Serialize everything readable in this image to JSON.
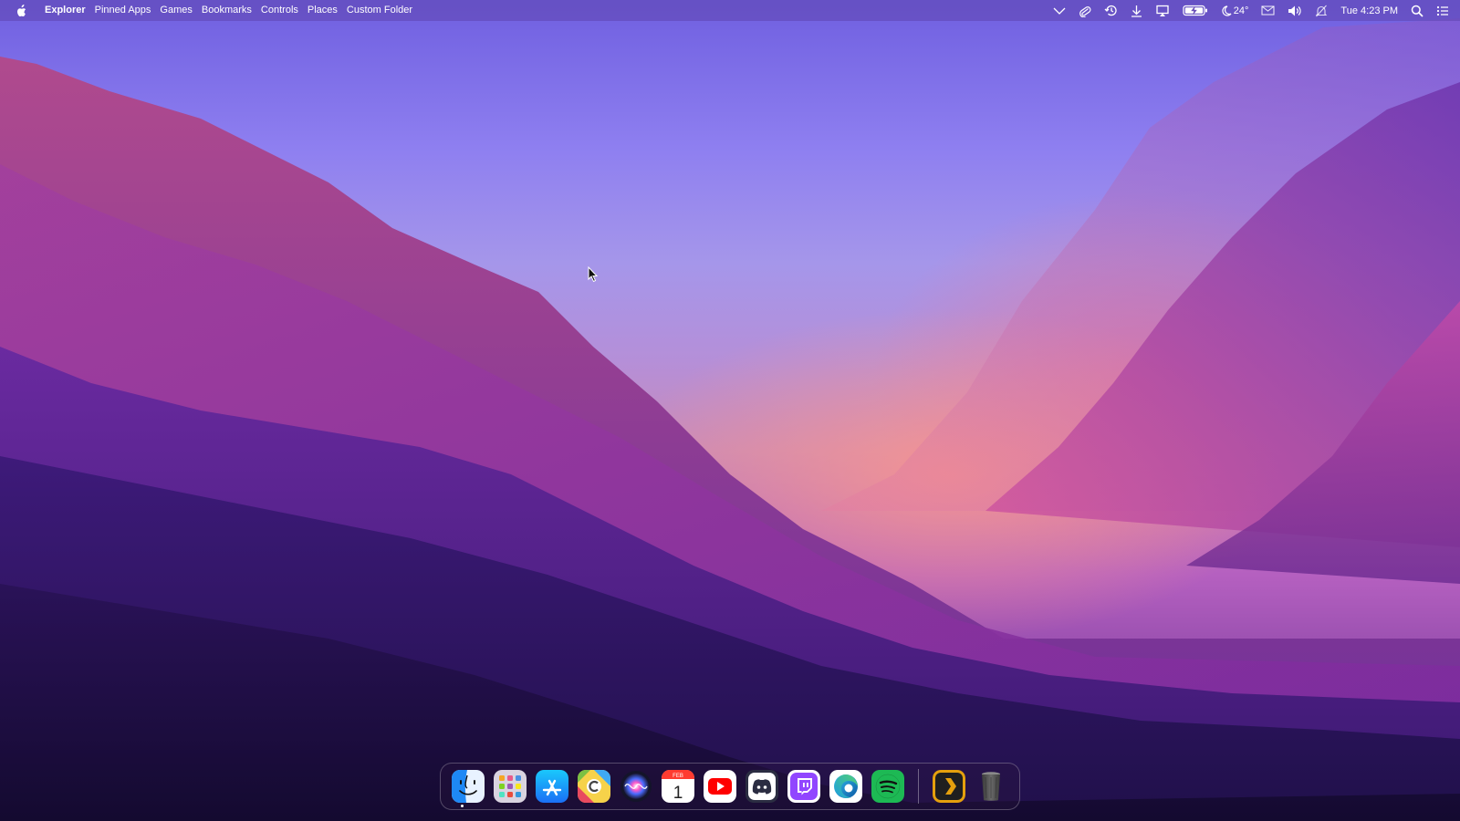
{
  "menubar": {
    "app_name": "Explorer",
    "menus": [
      "Pinned Apps",
      "Games",
      "Bookmarks",
      "Controls",
      "Places",
      "Custom Folder"
    ],
    "weather_temp": "24°",
    "clock": "Tue 4:23 PM"
  },
  "status_icons": [
    "chevron-down-icon",
    "paperclip-icon",
    "history-icon",
    "download-icon",
    "screen-mirror-icon",
    "battery-charging-icon",
    "moon-weather-icon",
    "mail-icon",
    "volume-icon",
    "notifications-off-icon",
    "search-icon",
    "control-center-icon"
  ],
  "dock": {
    "apps": [
      {
        "name": "Finder",
        "icon": "finder-icon",
        "running": true
      },
      {
        "name": "Launchpad",
        "icon": "launchpad-icon",
        "running": false
      },
      {
        "name": "App Store",
        "icon": "app-store-icon",
        "running": false
      },
      {
        "name": "CCleaner",
        "icon": "ccleaner-icon",
        "running": false
      },
      {
        "name": "Siri",
        "icon": "siri-icon",
        "running": false
      },
      {
        "name": "Calendar",
        "icon": "calendar-icon",
        "running": false
      },
      {
        "name": "YouTube",
        "icon": "youtube-icon",
        "running": false
      },
      {
        "name": "Discord",
        "icon": "discord-icon",
        "running": false
      },
      {
        "name": "Twitch",
        "icon": "twitch-icon",
        "running": false
      },
      {
        "name": "Microsoft Edge",
        "icon": "edge-icon",
        "running": false
      },
      {
        "name": "Spotify",
        "icon": "spotify-icon",
        "running": false
      },
      {
        "name": "Plex",
        "icon": "plex-icon",
        "running": false
      },
      {
        "name": "Trash",
        "icon": "trash-icon",
        "running": false
      }
    ],
    "calendar": {
      "month": "FEB",
      "day": "1"
    }
  },
  "colors": {
    "menubar_bg": "#5f46af",
    "youtube_red": "#ff0000",
    "spotify_green": "#1db954",
    "discord_blurple": "#5865f2",
    "twitch_purple": "#9146ff",
    "plex_orange": "#e5a00d"
  }
}
